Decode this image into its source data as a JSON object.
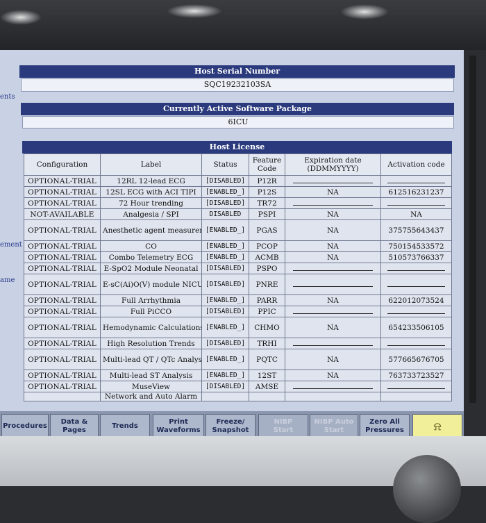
{
  "left_fragments": [
    "ents",
    "ement",
    "ame"
  ],
  "host_serial": {
    "title": "Host Serial Number",
    "value": "SQC19232103SA"
  },
  "software_package": {
    "title": "Currently Active Software Package",
    "value": "6ICU"
  },
  "license": {
    "title": "Host License",
    "headers": [
      "Configuration",
      "Label",
      "Status",
      "Feature Code",
      "Expiration date (DDMMYYYY)",
      "Activation code"
    ],
    "rows": [
      {
        "config": "OPTIONAL-TRIAL",
        "label": "12RL 12-lead ECG",
        "status": "[DISABLED]",
        "code": "P12R",
        "exp": "",
        "act": ""
      },
      {
        "config": "OPTIONAL-TRIAL",
        "label": "12SL ECG with ACI TIPI",
        "status": "[ENABLED_]",
        "code": "P12S",
        "exp": "NA",
        "act": "612516231237"
      },
      {
        "config": "OPTIONAL-TRIAL",
        "label": "72 Hour trending",
        "status": "[DISABLED]",
        "code": "TR72",
        "exp": "",
        "act": ""
      },
      {
        "config": "NOT-AVAILABLE",
        "label": "Analgesia / SPI",
        "status": "DISABLED",
        "code": "PSPI",
        "exp": "NA",
        "act": "NA"
      },
      {
        "config": "OPTIONAL-TRIAL",
        "label": "Anesthetic agent measurement",
        "status": "[ENABLED_]",
        "code": "PGAS",
        "exp": "NA",
        "act": "375755643437"
      },
      {
        "config": "OPTIONAL-TRIAL",
        "label": "CO",
        "status": "[ENABLED_]",
        "code": "PCOP",
        "exp": "NA",
        "act": "750154533572"
      },
      {
        "config": "OPTIONAL-TRIAL",
        "label": "Combo Telemetry ECG",
        "status": "[ENABLED_]",
        "code": "ACMB",
        "exp": "NA",
        "act": "510573766337"
      },
      {
        "config": "OPTIONAL-TRIAL",
        "label": "E-SpO2 Module Neonatal",
        "status": "[DISABLED]",
        "code": "PSPO",
        "exp": "",
        "act": ""
      },
      {
        "config": "OPTIONAL-TRIAL",
        "label": "E-sC(Ai)O(V) module NICU SW",
        "status": "[DISABLED]",
        "code": "PNRE",
        "exp": "",
        "act": ""
      },
      {
        "config": "OPTIONAL-TRIAL",
        "label": "Full Arrhythmia",
        "status": "[ENABLED_]",
        "code": "PARR",
        "exp": "NA",
        "act": "622012073524"
      },
      {
        "config": "OPTIONAL-TRIAL",
        "label": "Full PiCCO",
        "status": "[DISABLED]",
        "code": "PPIC",
        "exp": "",
        "act": ""
      },
      {
        "config": "OPTIONAL-TRIAL",
        "label": "Hemodynamic Calculations",
        "status": "[ENABLED_]",
        "code": "CHMO",
        "exp": "NA",
        "act": "654233506105"
      },
      {
        "config": "OPTIONAL-TRIAL",
        "label": "High Resolution Trends",
        "status": "[DISABLED]",
        "code": "TRHI",
        "exp": "",
        "act": ""
      },
      {
        "config": "OPTIONAL-TRIAL",
        "label": "Multi-lead QT / QTc Analysis",
        "status": "[ENABLED_]",
        "code": "PQTC",
        "exp": "NA",
        "act": "577665676705"
      },
      {
        "config": "OPTIONAL-TRIAL",
        "label": "Multi-lead ST Analysis",
        "status": "[ENABLED_]",
        "code": "12ST",
        "exp": "NA",
        "act": "763733723527"
      },
      {
        "config": "OPTIONAL-TRIAL",
        "label": "MuseView",
        "status": "[DISABLED]",
        "code": "AMSE",
        "exp": "",
        "act": ""
      },
      {
        "config": "",
        "label": "Network and Auto Alarm",
        "status": "",
        "code": "",
        "exp": "",
        "act": ""
      }
    ]
  },
  "softkeys": [
    {
      "label": "Procedures",
      "enabled": true
    },
    {
      "label": "Data & Pages",
      "enabled": true
    },
    {
      "label": "Trends",
      "enabled": true
    },
    {
      "label": "Print Waveforms",
      "enabled": true
    },
    {
      "label": "Freeze/ Snapshot",
      "enabled": true
    },
    {
      "label": "NIBP Start",
      "enabled": false
    },
    {
      "label": "NIBP Auto Start",
      "enabled": false
    },
    {
      "label": "Zero All Pressures",
      "enabled": true
    },
    {
      "label": "",
      "icon": "alarm-bell-icon",
      "enabled": true
    }
  ],
  "colors": {
    "title_bar": "#2a3a7c",
    "screen_bg": "#c9d2e4",
    "alarm_key": "#f2ef9a"
  }
}
